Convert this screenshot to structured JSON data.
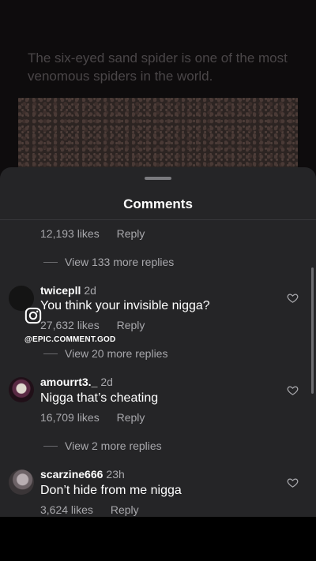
{
  "post": {
    "caption": "The six-eyed sand spider is one of the most venomous spiders in the world."
  },
  "sheet": {
    "title": "Comments"
  },
  "top_partial": {
    "likes": "12,193 likes",
    "reply": "Reply",
    "more_replies": "View 133 more replies"
  },
  "comments": [
    {
      "username": "twicepll",
      "time": "2d",
      "text": "You think your invisible nigga?",
      "likes": "27,632 likes",
      "reply": "Reply",
      "more_replies": "View 20 more replies"
    },
    {
      "username": "amourrt3._",
      "time": "2d",
      "text": "Nigga that’s cheating",
      "likes": "16,709 likes",
      "reply": "Reply",
      "more_replies": "View 2 more replies"
    },
    {
      "username": "scarzine666",
      "time": "23h",
      "text": "Don’t hide from me nigga",
      "likes": "3,624 likes",
      "reply": "Reply"
    }
  ],
  "watermark": {
    "handle": "@EPIC.COMMENT.GOD",
    "icon": "instagram-icon"
  },
  "colors": {
    "sheet_bg": "#252527",
    "muted_text": "#a8a8ac"
  }
}
